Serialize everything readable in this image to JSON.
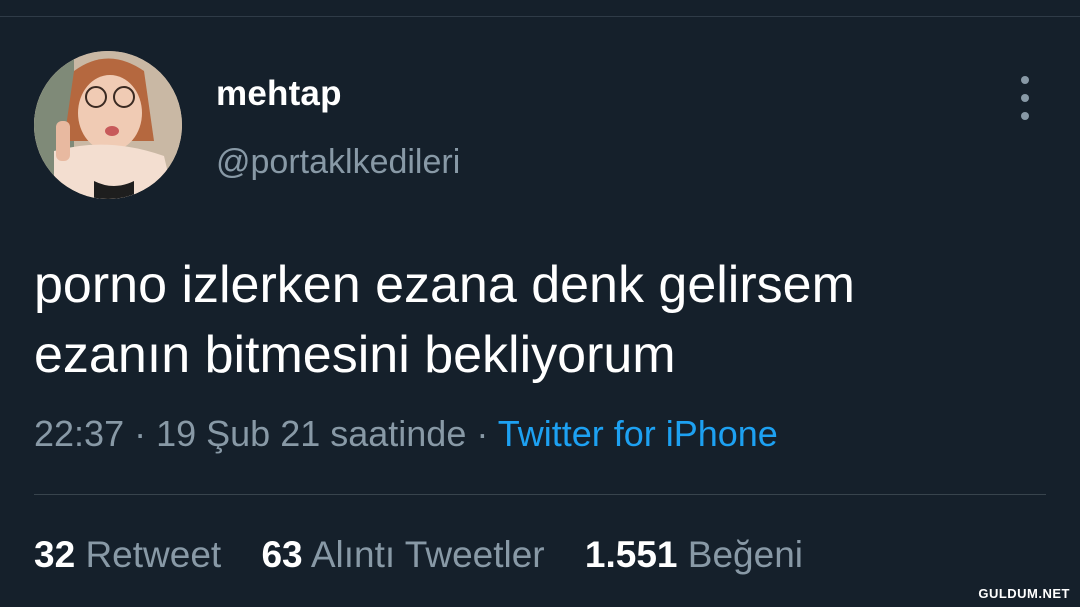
{
  "tweet": {
    "display_name": "mehtap",
    "handle": "@portaklkedileri",
    "text_lines": [
      "porno izlerken ezana denk gelirsem",
      "ezanın bitmesini bekliyorum"
    ],
    "time": "22:37",
    "separator": " · ",
    "date_text": "19 Şub 21 saatinde",
    "source": "Twitter for iPhone"
  },
  "stats": {
    "retweets_count": "32",
    "retweets_label": "Retweet",
    "quotes_count": "63",
    "quotes_label": "Alıntı Tweetler",
    "likes_count": "1.551",
    "likes_label": "Beğeni"
  },
  "watermark": "GULDUM.NET",
  "icons": {
    "more": "more-vertical-icon"
  },
  "colors": {
    "background": "#15202b",
    "muted": "#8899a6",
    "link": "#1da1f2"
  }
}
